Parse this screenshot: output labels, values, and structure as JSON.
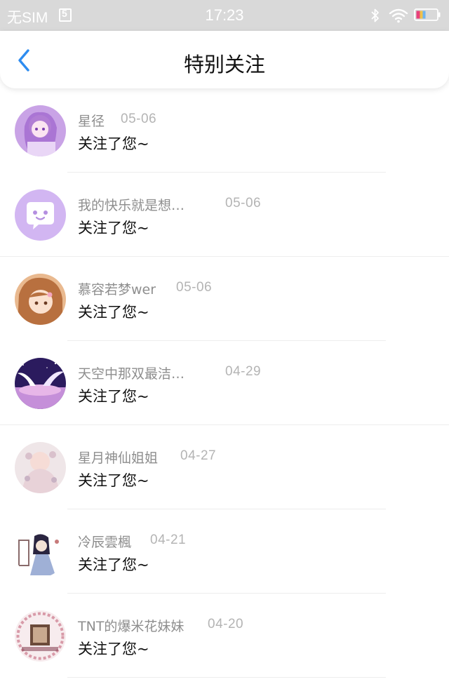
{
  "status_bar": {
    "carrier": "无SIM",
    "time": "17:23",
    "icons": [
      "sim-icon",
      "bluetooth-icon",
      "wifi-icon",
      "battery-icon"
    ]
  },
  "header": {
    "title": "特别关注",
    "back_icon": "chevron-left-icon",
    "accent_color": "#2d8cf0"
  },
  "items": [
    {
      "name": "星径",
      "date": "05-06",
      "message": "关注了您~"
    },
    {
      "name": "我的快乐就是想…",
      "date": "05-06",
      "message": "关注了您~"
    },
    {
      "name": "慕容若梦wer",
      "date": "05-06",
      "message": "关注了您~"
    },
    {
      "name": "天空中那双最洁…",
      "date": "04-29",
      "message": "关注了您~"
    },
    {
      "name": "星月神仙姐姐",
      "date": "04-27",
      "message": "关注了您~"
    },
    {
      "name": "冷辰雲楓",
      "date": "04-21",
      "message": "关注了您~"
    },
    {
      "name": "TNT的爆米花妹妹",
      "date": "04-20",
      "message": "关注了您~"
    }
  ],
  "colors": {
    "status_bar_bg": "#d9d9d9",
    "name_text": "#8e8e8e",
    "date_text": "#b4b4b4",
    "message_text": "#111111"
  }
}
